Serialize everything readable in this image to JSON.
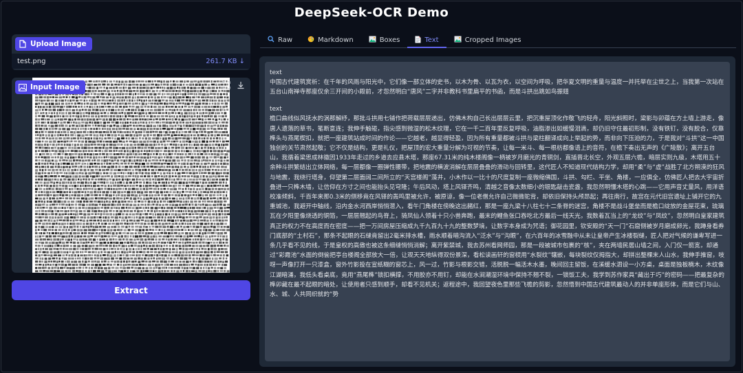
{
  "app": {
    "title": "DeepSeek-OCR Demo"
  },
  "upload": {
    "label": "Upload Image",
    "file_name": "test.png",
    "file_size": "261.7 KB ↓"
  },
  "input_image": {
    "label": "Input Image"
  },
  "extract_button": {
    "label": "Extract"
  },
  "tabs": [
    {
      "label": "Raw",
      "icon": "search-icon"
    },
    {
      "label": "Markdown",
      "icon": "palette-icon"
    },
    {
      "label": "Boxes",
      "icon": "image-icon"
    },
    {
      "label": "Text",
      "icon": "document-icon"
    },
    {
      "label": "Cropped Images",
      "icon": "image-icon"
    }
  ],
  "active_tab": "Text",
  "output": {
    "blocks": [
      {
        "label": "text",
        "text": "中国古代建筑赏析：在千年的风雨与阳光中，它们像一部立体的史书，以木为骨、以瓦为衣，以空间为呼吸，把华夏文明的重量与温度一并托举在尘世之上，当我第一次站在五台山南禅寺那座仅余三开间的小殿前，才忽然明白“唐风”二字并非教科书里扁平的书函，而是斗拱出跳如鸟振翅"
      },
      {
        "label": "text",
        "text": "檐口曲线似风抚水的涡那解纾，那批斗拱用七铺作把荷载层层递出，仿佛木构自己长出层层云里，把沉重屋顶化作敬飞的轻舟，阳光斜照时，梁影与卯蕴在方土墙上游走，像唐人遗落的草书，笔断意连；我伸手触碰，指尖感到微湿的松木纹理，它在一千二百年里反复呼吸，油脂渗出如缓慢泪滴，却仍旧守住最初形制，没有铁钉，没有胶合，仅靠榫头与燕尾楔扣，就把一座建筑站成时间的作论——它越老，越显得轻盈，因为所有重量都被斗拱与梁柱翻译成向上举起的势，而非向下压迫的力，于是我对“斗拱”这一中国独创的关节肃然起敬；它不仅是结构，更是礼仪，把屋顶的宏大重量分解为可视的节奏，让每一米斗、每一根枋都像语上的音符，在檐下奏出无声的《广陵散》；离开五台山，我循着梁思成林徽因1933年走过的乡道去应县木塔，那座67.31米的纯木楼阁像一柄被岁月磨光的青铜剑，直插晋北长空，外观五层六檐，暗层实则九级，木塔用五十余种斗拱繁结出立体网络，每一层都像一圈弹性腰带，把地震的横波消解在层层叠叠的滑动与回转里，这代匠人不知道现代结构力学，却用“柔”与“虚”战胜了北方朔漠的狂风与地震，我绕行塔身，仰望第二层面阔二间所立的“天宫楼阁”藻井，小木作以一比十的尺度复制一座微缩佛国，斗拱、勾栏、平坐、角楼，一应俱全，仿佛匠人把去大宇宙折叠进一只榫木墙，让信仰在方寸之间也能抬头见穹隆；午后风动，塔上风铎齐鸣，清越之音像太数细小的银匙敲击瓷盏，我忽然明懂木塔的心跳——它用声音丈量风，用洋语校准倾斜，千百年来那0.3米的侧移竟在风铎的轰鸣里被允许，被原谅，像一位老僧允许自己微微驼背，却依旧保持头颅昂起；再往南行，故宫在元代旧宫遗址上铺开它的九重城池，我避开中轴线，沿内金水河西岸悄悄潜入，看午门角楼在傍晚这出赭红，那是一座九梁十八柱七十二条脊的迷宫，角楼不是战斗堡垒而是檐口绽放的金屋花束，琉璃瓦在夕阳里像烧透的铜箔，一层层翘起的鸟脊上，骑凤仙人领着十只小兽奔跑，最末的鲤鱼张口吞吃北方最后一线天光，我数着瓦当上的“龙纹”与“凤纹”，忽然明白皇家建筑真正的权力不在高度而在密度——把一万间房屋压缩成九千九百九十九的整数梦境，让数字本身成为咒语；御花园里，钦安殿的“天一门”石窟侧被岁月磨成卵光，我蹲身看券门底部的“土村石”，那条不起眼的石缝竟留出2毫米排水槽，雨水顺着暗沟流入“泛水”与“沟眼”，在六百年的冰雪融中从未让皇帝产生冰楼裂缝，匠人把对气候的谦卑写进一条几乎看不见的线，于是皇权的高傲也被这条细缝悄悄消解；离开紫禁城，我去苏州看网师园，那是一段被城市包裹的“核”，夹在两墙民居山墙之间，入门仅一箭宽，却通过“彩霞池”水面的倒偷把亭台楼阁全部放大一倍，让观天天地纵得双份景深，看松读画轩的窗棂用“水裂纹”镶嵌，每块裂纹仅拇指大，却拼出整棵末人山水，我伸手推窗，吱呀一声像打开一只漆盒，窗外竹影投在宣纸糊的窗芯上，风一过，竹影与根影交错，活脱脱一幅活木水墨，晚间回主留饭，在溪缓水泗设一小方桌，桌面是独板楠木，木纹像江湖暗涌，我低头看桌底，竟用“燕尾榫”锁扣横撑，不用胶亦不用钉，却能在水涧潮湿环境中保持不翘不裂，一锁饭工夫，我学到苏作家具“藏出于巧”的密码——把最复杂的榫卯藏在最不起眼的暗处，让使用者只感到顺手，却看不见机关；返程途中，我回望夜色里那些飞檐的剪影，忽然悟到中国古代建筑最动人的并非单座形体，而是它们与山、水、城、人共同织就的“势"
      }
    ]
  },
  "colors": {
    "background": "#0b0f19",
    "panel": "#1f2937",
    "accent": "#4f46e5",
    "tab_active": "#818cf8"
  }
}
